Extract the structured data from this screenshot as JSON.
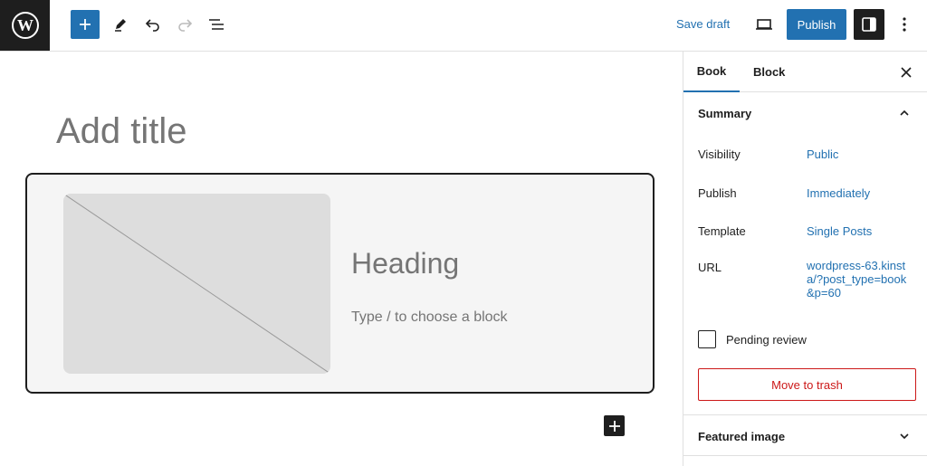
{
  "toolbar": {
    "save_draft": "Save draft",
    "publish": "Publish"
  },
  "editor": {
    "title_placeholder": "Add title",
    "heading_placeholder": "Heading",
    "paragraph_placeholder": "Type / to choose a block"
  },
  "sidebar": {
    "tabs": [
      {
        "label": "Book",
        "active": true
      },
      {
        "label": "Block",
        "active": false
      }
    ],
    "summary": {
      "title": "Summary",
      "rows": [
        {
          "label": "Visibility",
          "value": "Public"
        },
        {
          "label": "Publish",
          "value": "Immediately"
        },
        {
          "label": "Template",
          "value": "Single Posts"
        },
        {
          "label": "URL",
          "value": "wordpress-63.kinsta/?post_type=book&p=60"
        }
      ],
      "pending_review": "Pending review",
      "pending_checked": false,
      "move_to_trash": "Move to trash"
    },
    "featured_image": "Featured image"
  },
  "colors": {
    "accent": "#2271b1",
    "dark": "#1e1e1e",
    "danger": "#cc1818"
  }
}
